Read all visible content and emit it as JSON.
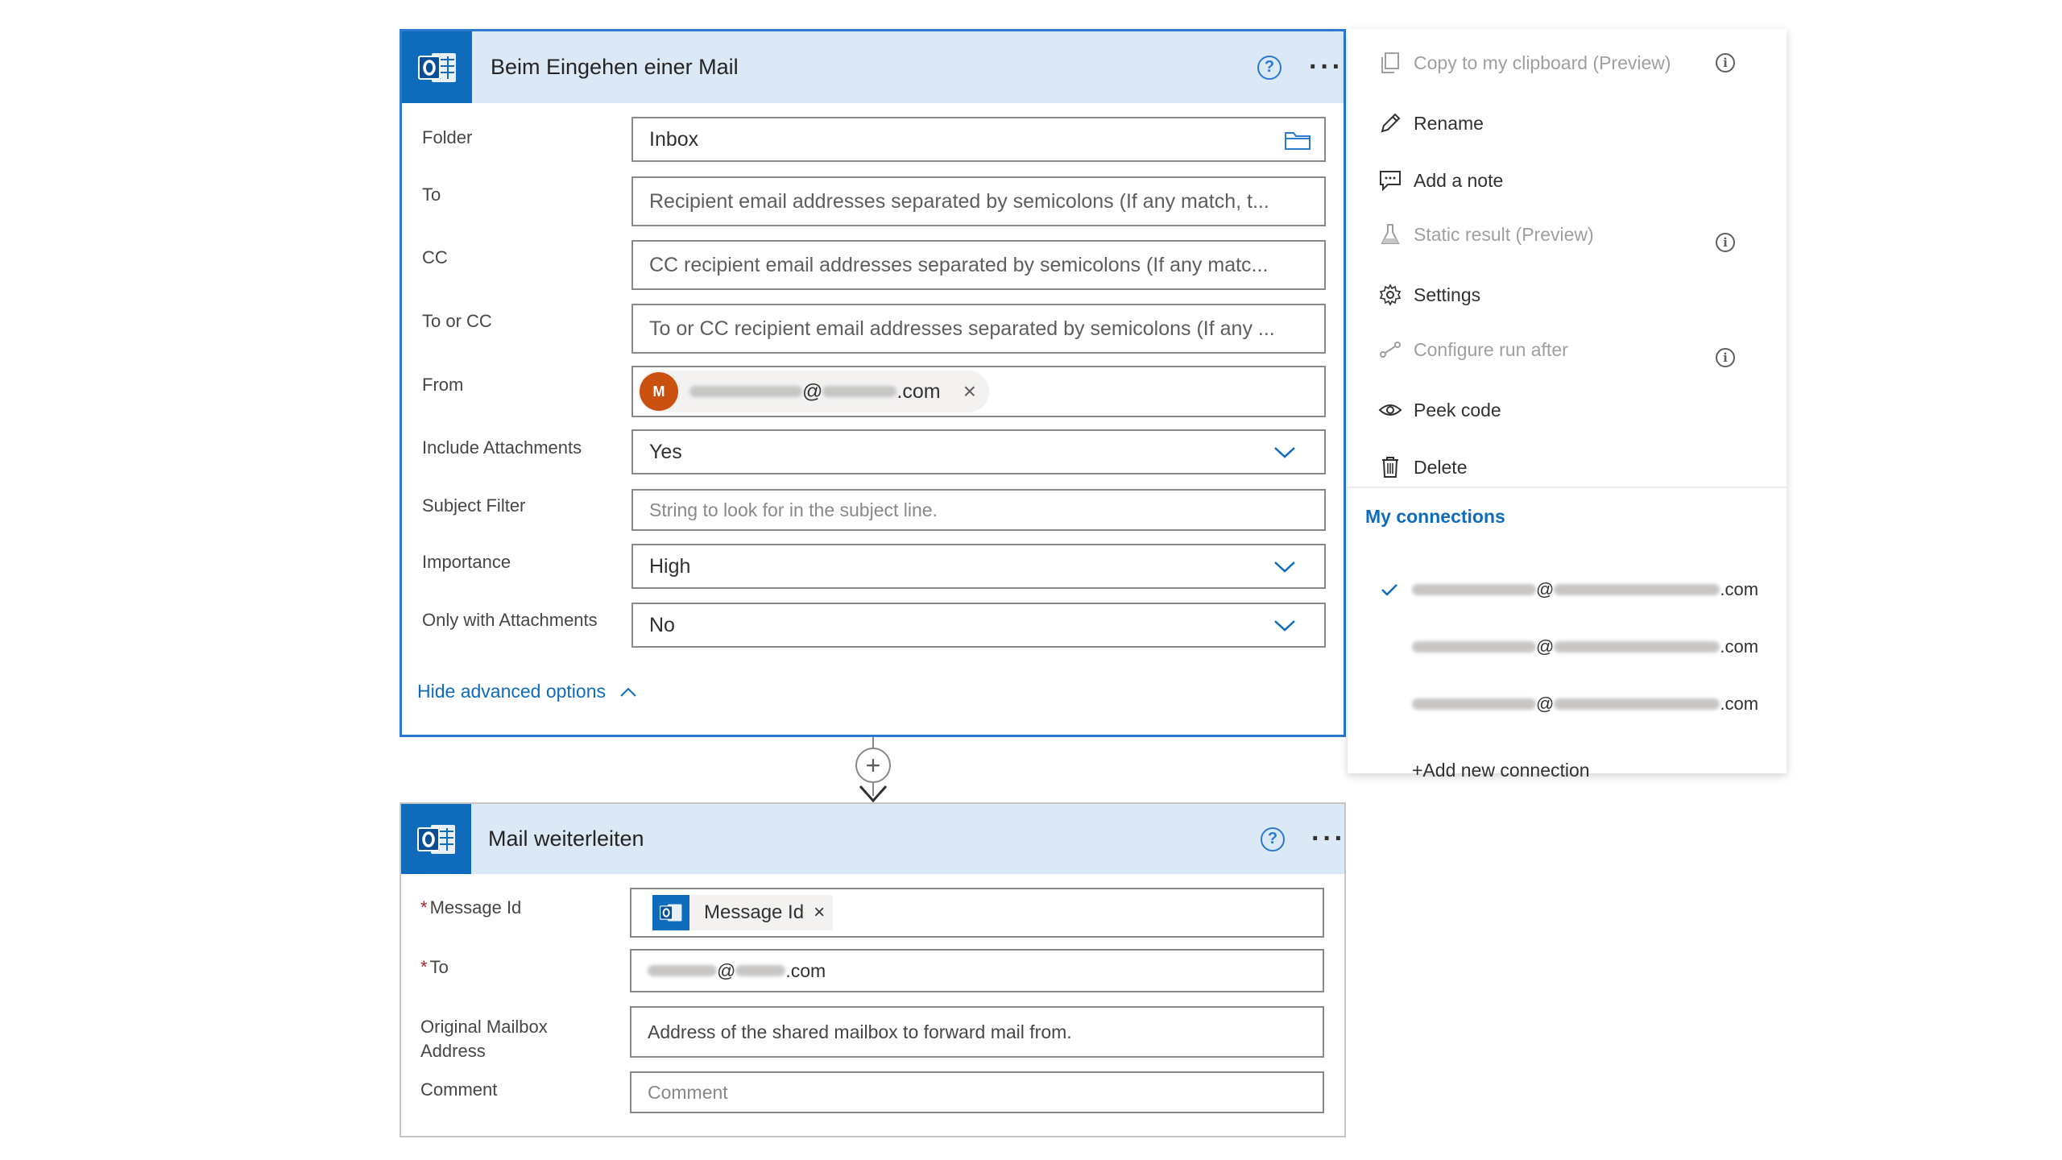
{
  "trigger": {
    "title": "Beim Eingehen einer Mail",
    "help_icon": "?",
    "more_icon": "···",
    "fields": {
      "folder_label": "Folder",
      "folder_value": "Inbox",
      "to_label": "To",
      "to_placeholder": "Recipient email addresses separated by semicolons (If any match, t...",
      "cc_label": "CC",
      "cc_placeholder": "CC recipient email addresses separated by semicolons (If any matc...",
      "to_or_cc_label": "To or CC",
      "to_or_cc_placeholder": "To or CC recipient email addresses separated by semicolons (If any ...",
      "from_label": "From",
      "from_avatar": "M",
      "from_value_at": "@",
      "from_value_domain": ".com",
      "from_remove": "×",
      "include_attachments_label": "Include Attachments",
      "include_attachments_value": "Yes",
      "subject_filter_label": "Subject Filter",
      "subject_filter_placeholder": "String to look for in the subject line.",
      "importance_label": "Importance",
      "importance_value": "High",
      "only_attachments_label": "Only with Attachments",
      "only_attachments_value": "No"
    },
    "hide_advanced": "Hide advanced options"
  },
  "connector": {
    "add_icon": "+"
  },
  "action": {
    "title": "Mail weiterleiten",
    "help_icon": "?",
    "more_icon": "···",
    "fields": {
      "required_mark": "*",
      "message_id_label": "Message Id",
      "message_id_token": "Message Id",
      "message_id_remove": "×",
      "to_label": "To",
      "to_value_at": "@",
      "to_value_domain": ".com",
      "original_mailbox_label_line1": "Original Mailbox",
      "original_mailbox_label_line2": "Address",
      "original_mailbox_placeholder": "Address of the shared mailbox to forward mail from.",
      "comment_label": "Comment",
      "comment_placeholder": "Comment"
    }
  },
  "menu": {
    "items": [
      {
        "label": "Copy to my clipboard (Preview)",
        "icon": "copy-icon",
        "disabled": true,
        "info": true
      },
      {
        "label": "Rename",
        "icon": "pencil-icon",
        "disabled": false
      },
      {
        "label": "Add a note",
        "icon": "note-icon",
        "disabled": false
      },
      {
        "label": "Static result (Preview)",
        "icon": "flask-icon",
        "disabled": true,
        "info": true
      },
      {
        "label": "Settings",
        "icon": "gear-icon",
        "disabled": false
      },
      {
        "label": "Configure run after",
        "icon": "run-after-icon",
        "disabled": true,
        "info": true
      },
      {
        "label": "Peek code",
        "icon": "eye-icon",
        "disabled": false
      },
      {
        "label": "Delete",
        "icon": "trash-icon",
        "disabled": false
      }
    ],
    "info_glyph": "i",
    "connections_heading": "My connections",
    "connections": [
      {
        "at": "@",
        "suffix": ".com",
        "selected": true
      },
      {
        "at": "@",
        "suffix": ".com",
        "selected": false
      },
      {
        "at": "@",
        "suffix": ".com",
        "selected": false
      }
    ],
    "add_connection": "+Add new connection"
  },
  "colors": {
    "accent": "#2b79d0",
    "header_bg": "#dbe9f7",
    "outlook_blue": "#0f6cbd",
    "avatar": "#ca5010"
  }
}
